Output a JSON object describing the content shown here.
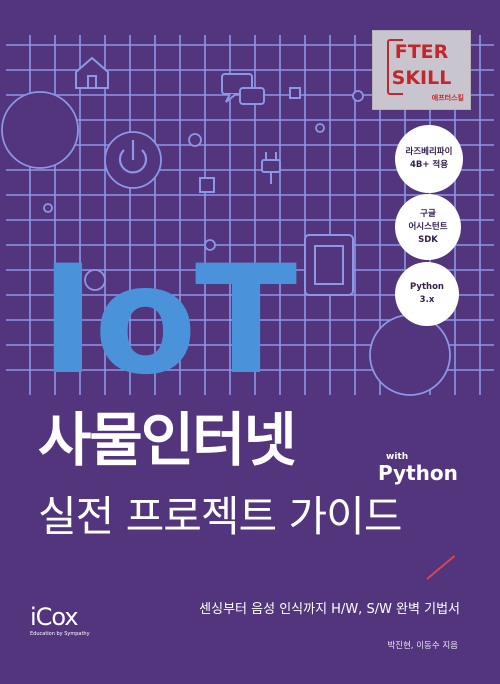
{
  "publisher_badge": {
    "row1": "FTER",
    "row2": "SKILL",
    "sub": "애프터스킬"
  },
  "features": [
    {
      "lines": [
        "라즈베리파이",
        "4B+ 적용"
      ]
    },
    {
      "lines": [
        "구글",
        "어시스턴트",
        "SDK"
      ]
    },
    {
      "lines": [
        "Python",
        "3.x"
      ]
    }
  ],
  "cover": {
    "iot": "IoT",
    "title": "사물인터넷",
    "with": "with",
    "python": "Python",
    "subtitle": "실전 프로젝트 가이드",
    "tagline": "센싱부터 음성 인식까지 H/W, S/W 완벽 기법서",
    "authors": "박진현, 이동수 지음"
  },
  "logo": {
    "mark": "iCox",
    "slogan": "Education by Sympathy"
  },
  "colors": {
    "background": "#52357d",
    "grid": "#8c97e6",
    "accent_blue": "#4a93db",
    "badge_red": "#c3272e",
    "slash": "#d6455c"
  }
}
